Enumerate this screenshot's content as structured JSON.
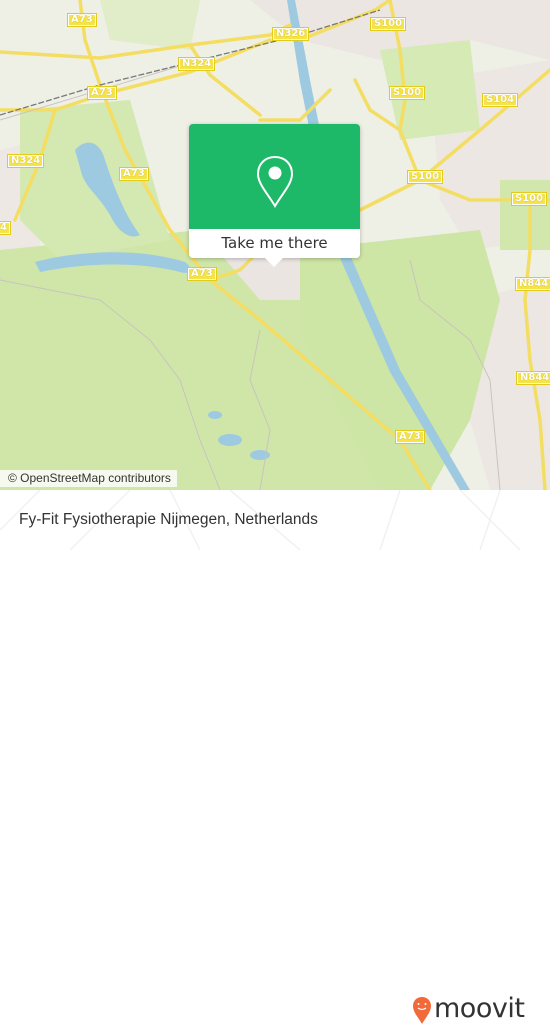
{
  "map": {
    "road_labels": [
      {
        "id": "a73-top",
        "text": "A73"
      },
      {
        "id": "n324-top",
        "text": "N324"
      },
      {
        "id": "a73-mid",
        "text": "A73"
      },
      {
        "id": "n324-left",
        "text": "N324"
      },
      {
        "id": "a73-lake",
        "text": "A73"
      },
      {
        "id": "edge-4",
        "text": "4"
      },
      {
        "id": "n326",
        "text": "N326"
      },
      {
        "id": "s100-top",
        "text": "S100"
      },
      {
        "id": "s100-2",
        "text": "S100"
      },
      {
        "id": "s104",
        "text": "S104"
      },
      {
        "id": "s100-3",
        "text": "S100"
      },
      {
        "id": "s100-right",
        "text": "S100"
      },
      {
        "id": "a73-popup",
        "text": "A73"
      },
      {
        "id": "n844-top",
        "text": "N844"
      },
      {
        "id": "n844-bottom",
        "text": "N844"
      },
      {
        "id": "a73-bottom",
        "text": "A73"
      }
    ],
    "attribution": "© OpenStreetMap contributors"
  },
  "popup": {
    "icon": "map-pin-icon",
    "button_label": "Take me there",
    "accent_color": "#1db868"
  },
  "footer": {
    "place_name": "Fy-Fit Fysiotherapie Nijmegen, Netherlands",
    "brand": "moovit",
    "brand_color": "#f26a3a"
  }
}
